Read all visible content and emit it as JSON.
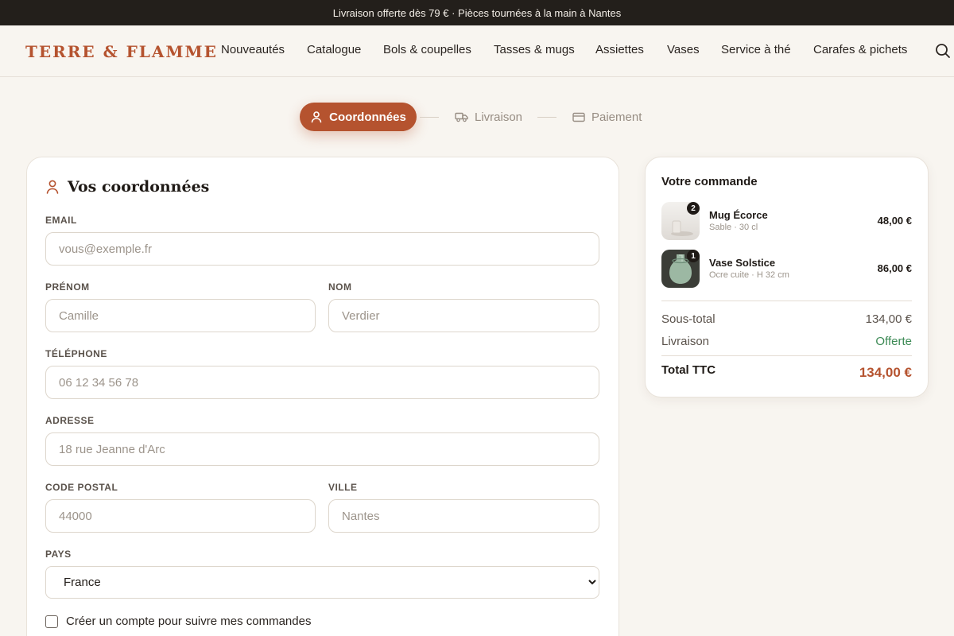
{
  "announcement": "Livraison offerte dès 79 € · Pièces tournées à la main à Nantes",
  "brand": {
    "name": "TERRE & FLAMME",
    "accent": "#b5532f"
  },
  "nav": {
    "items": [
      "Nouveautés",
      "Catalogue",
      "Bols & coupelles",
      "Tasses & mugs",
      "Assiettes",
      "Vases",
      "Service à thé",
      "Carafes & pichets"
    ],
    "search_icon": "search-icon"
  },
  "steps": [
    {
      "label": "Coordonnées",
      "icon": "user-icon",
      "active": true
    },
    {
      "label": "Livraison",
      "icon": "truck-icon",
      "active": false
    },
    {
      "label": "Paiement",
      "icon": "credit-card-icon",
      "active": false
    }
  ],
  "form": {
    "title": "Vos coordonnées",
    "email": {
      "label": "EMAIL",
      "placeholder": "vous@exemple.fr",
      "value": ""
    },
    "first_name": {
      "label": "PRÉNOM",
      "placeholder": "Camille",
      "value": ""
    },
    "last_name": {
      "label": "NOM",
      "placeholder": "Verdier",
      "value": ""
    },
    "phone": {
      "label": "TÉLÉPHONE",
      "placeholder": "06 12 34 56 78",
      "value": ""
    },
    "address": {
      "label": "ADRESSE",
      "placeholder": "18 rue Jeanne d'Arc",
      "value": ""
    },
    "postal_code": {
      "label": "CODE POSTAL",
      "placeholder": "44000",
      "value": ""
    },
    "city": {
      "label": "VILLE",
      "placeholder": "Nantes",
      "value": ""
    },
    "country": {
      "label": "PAYS",
      "selected": "France"
    },
    "create_account": {
      "label": "Créer un compte pour suivre mes commandes",
      "checked": false
    }
  },
  "order": {
    "title": "Votre commande",
    "items": [
      {
        "name": "Mug Écorce",
        "variant": "Sable · 30 cl",
        "price": "48,00 €",
        "qty": "2"
      },
      {
        "name": "Vase Solstice",
        "variant": "Ocre cuite · H 32 cm",
        "price": "86,00 €",
        "qty": "1"
      }
    ],
    "subtotal_label": "Sous-total",
    "subtotal": "134,00 €",
    "shipping_label": "Livraison",
    "shipping": "Offerte",
    "total_label": "Total TTC",
    "total": "134,00 €",
    "colors": {
      "free": "#3c8a55",
      "total": "#b5532f"
    }
  }
}
